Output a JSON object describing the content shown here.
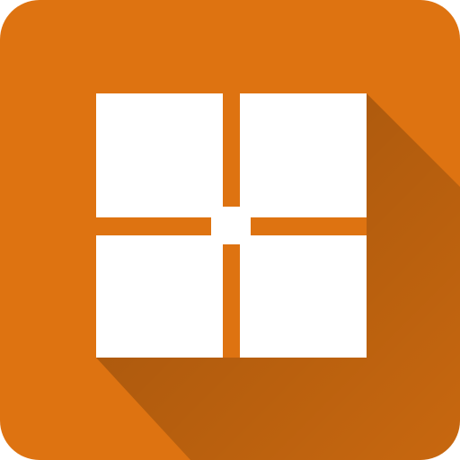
{
  "app_icon": {
    "icon": "grid-four-squares-icon",
    "colors": {
      "background": "#DE7311",
      "tile": "#FFFFFF",
      "shadow": "#A65610"
    }
  }
}
